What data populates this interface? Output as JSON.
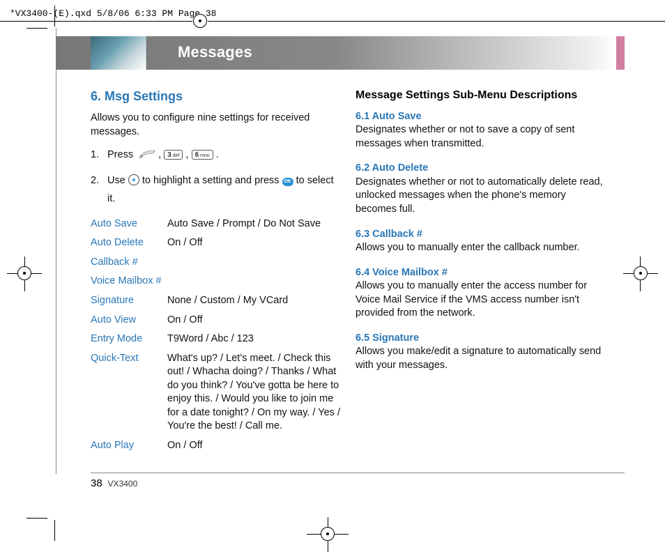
{
  "header_strip": "*VX3400-(E).qxd  5/8/06  6:33 PM  Page 38",
  "banner_title": "Messages",
  "left": {
    "section_title": "6. Msg Settings",
    "intro": "Allows you to configure nine settings for received messages.",
    "step1_prefix": "Press",
    "step1_k1": "3 def",
    "step1_k2": "6 mno",
    "step2a": "Use",
    "step2b": "to highlight a setting and press",
    "step2c": "to select it.",
    "rows": {
      "auto_save_k": "Auto Save",
      "auto_save_v": "Auto Save / Prompt / Do Not Save",
      "auto_delete_k": "Auto Delete",
      "auto_delete_v": "On / Off",
      "callback_k": "Callback #",
      "callback_v": "",
      "voicemail_k": "Voice Mailbox #",
      "voicemail_v": "",
      "signature_k": "Signature",
      "signature_v": "None / Custom / My VCard",
      "auto_view_k": "Auto View",
      "auto_view_v": "On / Off",
      "entry_mode_k": "Entry Mode",
      "entry_mode_v": "T9Word / Abc / 123",
      "quick_text_k": "Quick-Text",
      "quick_text_v": "What's up? / Let's meet. / Check this out! / Whacha doing? / Thanks / What do you think? / You've gotta be here to enjoy this. / Would you like to join me for a date tonight? / On my way. / Yes / You're the best! / Call me.",
      "auto_play_k": "Auto Play",
      "auto_play_v": "On / Off"
    }
  },
  "right": {
    "heading": "Message Settings Sub-Menu Descriptions",
    "items": {
      "i1_t": "6.1 Auto Save",
      "i1_b": "Designates whether or not to save a copy of sent messages when transmitted.",
      "i2_t": "6.2 Auto Delete",
      "i2_b": "Designates whether or not to automatically delete read, unlocked messages when the phone's memory becomes full.",
      "i3_t": "6.3 Callback #",
      "i3_b": "Allows you to manually enter the callback number.",
      "i4_t": "6.4 Voice Mailbox #",
      "i4_b": "Allows you to manually enter the access number for Voice Mail Service if the VMS access number isn't provided from the network.",
      "i5_t": "6.5 Signature",
      "i5_b": "Allows you make/edit a signature to automatically send with your messages."
    }
  },
  "page_number": "38",
  "model": "VX3400"
}
